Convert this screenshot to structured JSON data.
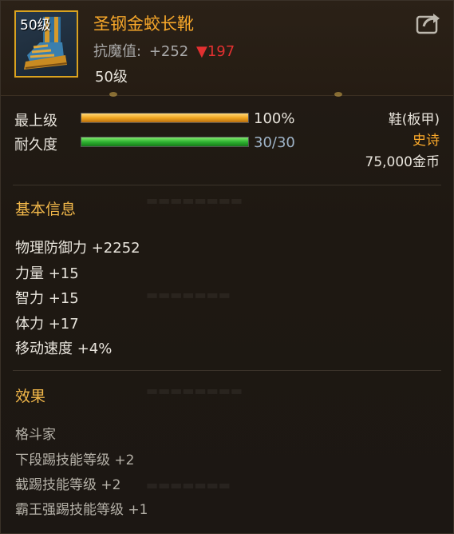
{
  "item": {
    "icon_level": "50级",
    "name": "圣钢金蛟长靴",
    "stat_label": "抗魔值:",
    "stat_value": "+252",
    "stat_diff_arrow": "▼",
    "stat_diff": "197",
    "level_req": "50级"
  },
  "bars": {
    "grade_label": "最上级",
    "grade_value": "100%",
    "grade_fraction": 1.0,
    "durability_label": "耐久度",
    "durability_value": "30/30",
    "durability_fraction": 1.0
  },
  "info": {
    "type": "鞋(板甲)",
    "rarity": "史诗",
    "price": "75,000金币"
  },
  "basic": {
    "title": "基本信息",
    "attrs": [
      "物理防御力 +2252",
      "力量 +15",
      "智力 +15",
      "体力 +17",
      "移动速度 +4%"
    ]
  },
  "effects": {
    "title": "效果",
    "lines": [
      "格斗家",
      "下段踢技能等级 +2",
      "截踢技能等级 +2",
      "霸王强踢技能等级 +1"
    ]
  },
  "colors": {
    "name": "#f7a72a",
    "rarity": "#f7a72a",
    "section": "#f2b84a",
    "diff_down": "#e23030",
    "icon_border": "#d9a21f",
    "durability_text": "#9fb4c8"
  },
  "icons": {
    "item": "boot-icon",
    "share": "share-icon"
  }
}
